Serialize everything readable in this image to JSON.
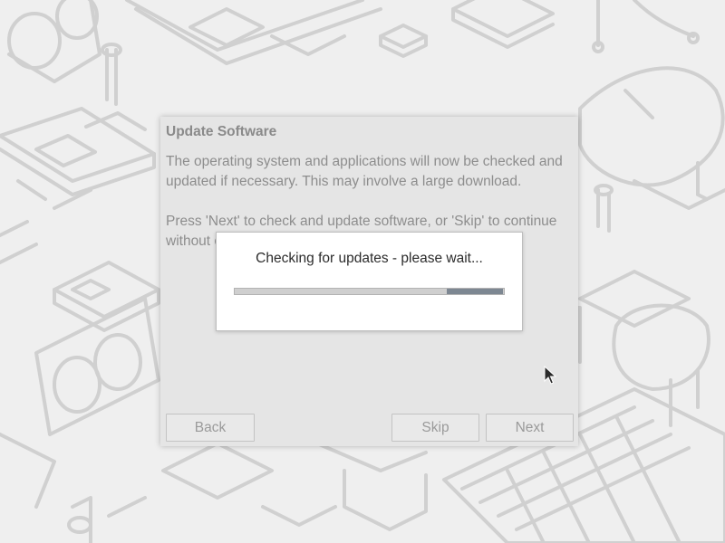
{
  "wizard": {
    "title": "Update Software",
    "paragraph1": "The operating system and applications will now be checked and updated if necessary. This may involve a large download.",
    "paragraph2": "Press 'Next' to check and update software, or 'Skip' to continue without checking.",
    "buttons": {
      "back": "Back",
      "skip": "Skip",
      "next": "Next"
    }
  },
  "progress_dialog": {
    "message": "Checking for updates - please wait...",
    "indeterminate": true
  },
  "colors": {
    "wallpaper": "#efefef",
    "wallpaper_lines": "#d2d2d2",
    "dialog": "#e5e5e5",
    "modal": "#ffffff",
    "progress_track": "#cfcfcf",
    "progress_pulse": "#7d8792"
  }
}
